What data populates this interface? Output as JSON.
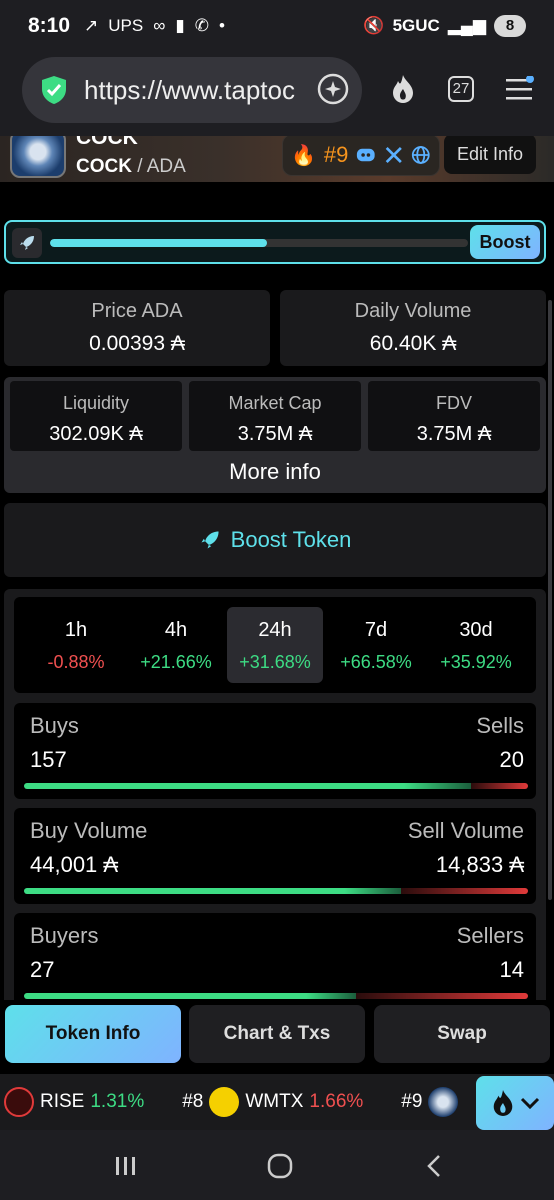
{
  "status": {
    "time": "8:10",
    "notif_ups": "UPS",
    "network": "5GUC",
    "battery": "8"
  },
  "browser": {
    "url": "https://www.taptoc",
    "tab_count": "27",
    "icons": [
      "shield-icon",
      "assistant-icon",
      "fire-icon",
      "tabs-icon",
      "menu-icon"
    ]
  },
  "token": {
    "name": "COCK",
    "base": "COCK",
    "quote": "/ ADA",
    "rank": "#9",
    "edit_label": "Edit Info"
  },
  "boost_bar": {
    "button_label": "Boost",
    "progress_pct": 52
  },
  "stats": {
    "price_label": "Price ADA",
    "price_value": "0.00393 ₳",
    "volume_label": "Daily Volume",
    "volume_value": "60.40K ₳",
    "liquidity_label": "Liquidity",
    "liquidity_value": "302.09K ₳",
    "mcap_label": "Market Cap",
    "mcap_value": "3.75M ₳",
    "fdv_label": "FDV",
    "fdv_value": "3.75M ₳",
    "more_info": "More info"
  },
  "boost_token": {
    "label": "Boost Token"
  },
  "timeframes": [
    {
      "label": "1h",
      "change": "-0.88%",
      "dir": "neg"
    },
    {
      "label": "4h",
      "change": "+21.66%",
      "dir": "pos"
    },
    {
      "label": "24h",
      "change": "+31.68%",
      "dir": "pos"
    },
    {
      "label": "7d",
      "change": "+66.58%",
      "dir": "pos"
    },
    {
      "label": "30d",
      "change": "+35.92%",
      "dir": "pos"
    }
  ],
  "activity": {
    "buys_label": "Buys",
    "buys_value": "157",
    "sells_label": "Sells",
    "sells_value": "20",
    "buys_ratio": 0.887,
    "buyvol_label": "Buy Volume",
    "buyvol_value": "44,001 ₳",
    "sellvol_label": "Sell Volume",
    "sellvol_value": "14,833 ₳",
    "buyvol_ratio": 0.748,
    "buyers_label": "Buyers",
    "buyers_value": "27",
    "sellers_label": "Sellers",
    "sellers_value": "14",
    "buyers_ratio": 0.659
  },
  "tabs": {
    "token_info": "Token Info",
    "chart_txs": "Chart & Txs",
    "swap": "Swap"
  },
  "ticker": [
    {
      "rank": "",
      "name": "RISE",
      "change": "1.31%",
      "dir": "pos"
    },
    {
      "rank": "#8",
      "name": "WMTX",
      "change": "1.66%",
      "dir": "neg"
    },
    {
      "rank": "#9",
      "name": "",
      "change": "",
      "dir": "pos"
    }
  ],
  "colors": {
    "accent": "#5ee0ea",
    "positive": "#3ddc84",
    "negative": "#f05050",
    "rank": "#f7941d"
  }
}
